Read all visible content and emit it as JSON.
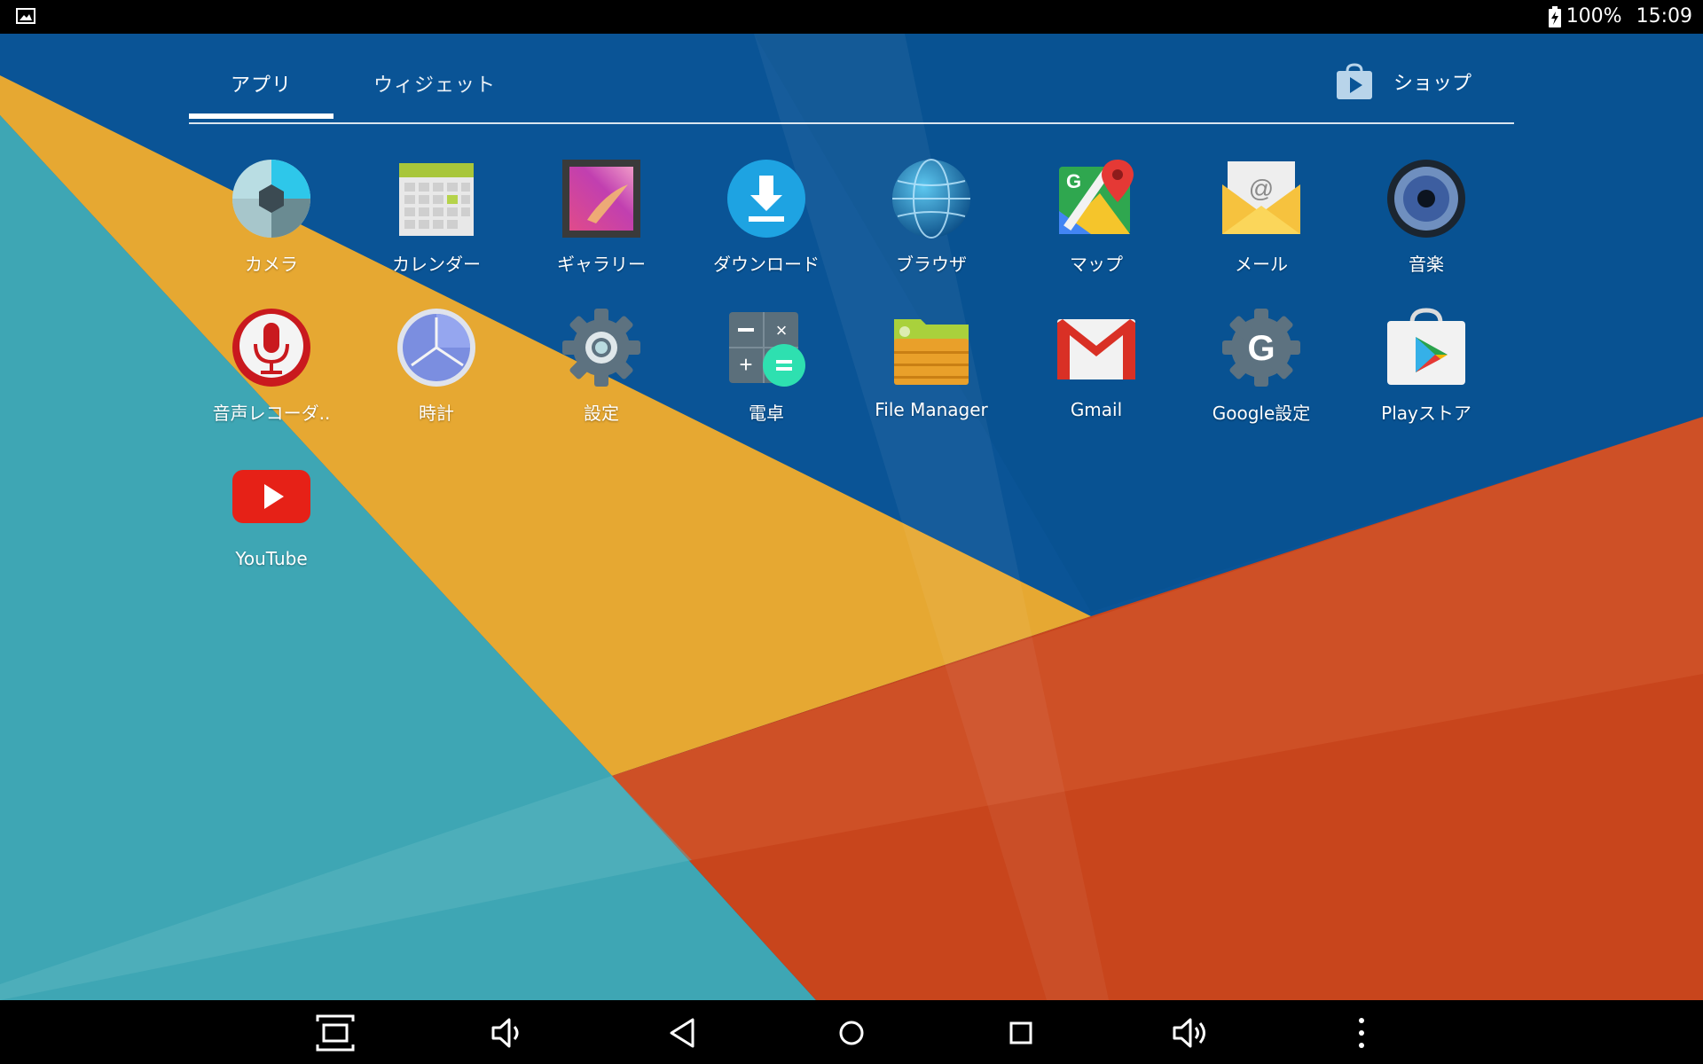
{
  "status_bar": {
    "battery_percent": "100%",
    "time": "15:09"
  },
  "tabs": {
    "apps": "アプリ",
    "widgets": "ウィジェット",
    "shop": "ショップ"
  },
  "apps": [
    {
      "label": "カメラ",
      "icon": "camera-icon"
    },
    {
      "label": "カレンダー",
      "icon": "calendar-icon"
    },
    {
      "label": "ギャラリー",
      "icon": "gallery-icon"
    },
    {
      "label": "ダウンロード",
      "icon": "download-icon"
    },
    {
      "label": "ブラウザ",
      "icon": "browser-globe-icon"
    },
    {
      "label": "マップ",
      "icon": "maps-icon"
    },
    {
      "label": "メール",
      "icon": "mail-icon"
    },
    {
      "label": "音楽",
      "icon": "music-speaker-icon"
    },
    {
      "label": "音声レコーダ..",
      "icon": "voice-recorder-mic-icon"
    },
    {
      "label": "時計",
      "icon": "clock-icon"
    },
    {
      "label": "設定",
      "icon": "settings-gear-icon"
    },
    {
      "label": "電卓",
      "icon": "calculator-icon"
    },
    {
      "label": "File Manager",
      "icon": "folder-icon"
    },
    {
      "label": "Gmail",
      "icon": "gmail-icon"
    },
    {
      "label": "Google設定",
      "icon": "google-settings-icon"
    },
    {
      "label": "Playストア",
      "icon": "play-store-icon"
    },
    {
      "label": "YouTube",
      "icon": "youtube-icon"
    }
  ],
  "nav_bar": [
    "screenshot-icon",
    "volume-down-icon",
    "back-icon",
    "home-icon",
    "recents-icon",
    "volume-up-icon",
    "more-icon"
  ],
  "colors": {
    "wall_blue": "#0a5496",
    "wall_teal": "#3ea6b4",
    "wall_yellow": "#e6a832",
    "wall_orange": "#c8451c"
  }
}
